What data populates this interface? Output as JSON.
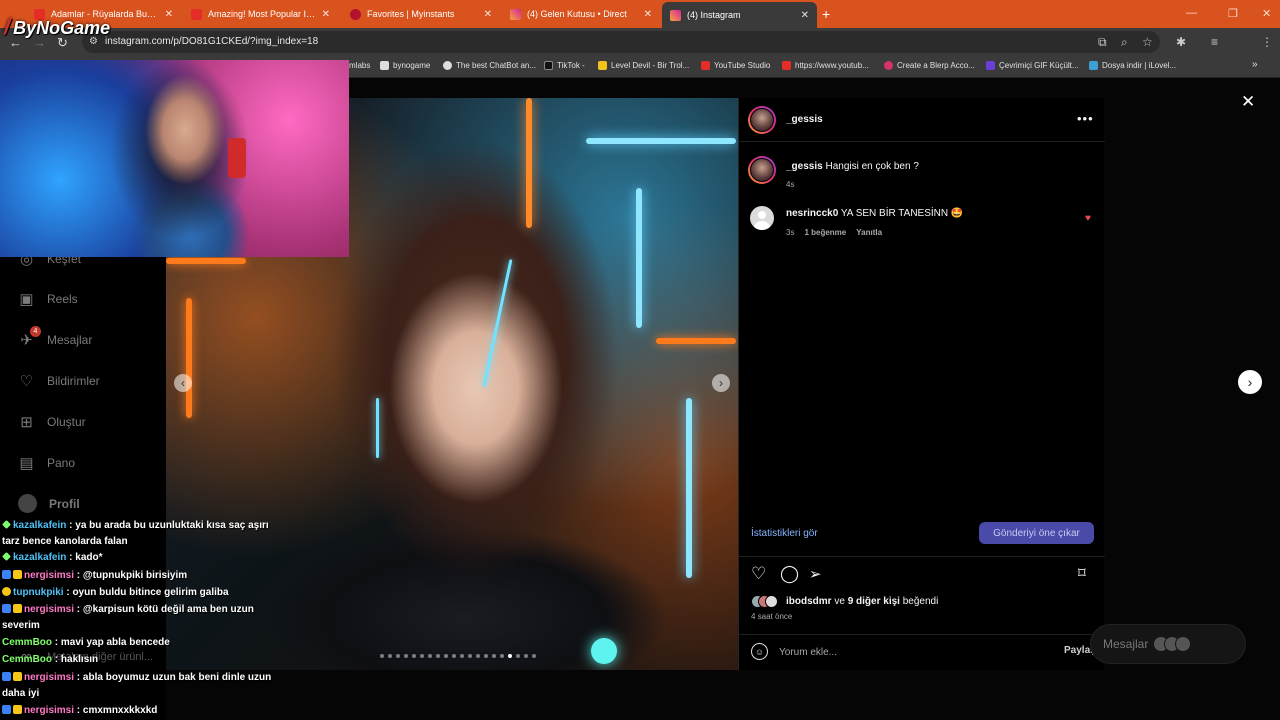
{
  "browser": {
    "tabs": [
      {
        "title": "Adamlar - Rüyalarda Buruşuk...",
        "fav": "#e52d27"
      },
      {
        "title": "Amazing! Most Popular Indian...",
        "fav": "#e52d27"
      },
      {
        "title": "Favorites | Myinstants",
        "fav": "#b3122e"
      },
      {
        "title": "(4) Gelen Kutusu • Direct",
        "fav": "#d6249f"
      },
      {
        "title": "(4) Instagram",
        "fav": "#d6249f"
      }
    ],
    "url": "instagram.com/p/DO81G1CKEd/?img_index=18",
    "bookmarks": [
      {
        "label": "mlabs",
        "color": "#888"
      },
      {
        "label": "bynogame",
        "color": "#ddd"
      },
      {
        "label": "The best ChatBot an...",
        "color": "#ddd"
      },
      {
        "label": "TikTok -",
        "color": "#222"
      },
      {
        "label": "Level Devil - Bir Trol...",
        "color": "#f2c21b"
      },
      {
        "label": "YouTube Studio",
        "color": "#e52d27"
      },
      {
        "label": "https://www.youtub...",
        "color": "#e52d27"
      },
      {
        "label": "Create a Blerp Acco...",
        "color": "#d6336c"
      },
      {
        "label": "Çevrimiçi GIF Küçült...",
        "color": "#6a3fd6"
      },
      {
        "label": "Dosya indir | iLovel...",
        "color": "#3fa0d6"
      }
    ]
  },
  "stream": {
    "logo": "ByNoGame",
    "chat": [
      {
        "badge": "#7fff6a",
        "user": "kazalkafein",
        "ucls": "u-blue",
        "msg": " : ya bu arada bu uzunluktaki kısa saç aşırı tarz bence kanolarda falan"
      },
      {
        "badge": "#7fff6a",
        "user": "kazalkafein",
        "ucls": "u-blue",
        "msg": " : kado*"
      },
      {
        "badge": "#3b82f6",
        "user": "nergisimsi",
        "ucls": "u-pink",
        "msg": " : @tupnukpiki birisiyim"
      },
      {
        "badge": "#f5c518",
        "user": "tupnukpiki",
        "ucls": "u-blue",
        "msg": " : oyun buldu bitince gelirim galiba"
      },
      {
        "badge": "#3b82f6",
        "user": "nergisimsi",
        "ucls": "u-pink",
        "msg": " : @karpisun kötü değil ama ben uzun severim"
      },
      {
        "badge": "",
        "user": "CemmBoo",
        "ucls": "u-green",
        "msg": " : mavi yap abla bencede"
      },
      {
        "badge": "",
        "user": "CemmBoo",
        "ucls": "u-green",
        "msg": " : haklısın"
      },
      {
        "badge": "#3b82f6",
        "user": "nergisimsi",
        "ucls": "u-pink",
        "msg": " : abla boyumuz uzun bak beni dinle uzun daha iyi"
      },
      {
        "badge": "#3b82f6",
        "user": "nergisimsi",
        "ucls": "u-pink",
        "msg": " : cmxmnxxkkxkd"
      }
    ]
  },
  "sidebar": {
    "items": [
      {
        "label": "Keşfet",
        "icon": "compass-icon"
      },
      {
        "label": "Reels",
        "icon": "reels-icon"
      },
      {
        "label": "Mesajlar",
        "icon": "messenger-icon",
        "badge": "4"
      },
      {
        "label": "Bildirimler",
        "icon": "heart-icon"
      },
      {
        "label": "Oluştur",
        "icon": "plus-square-icon"
      },
      {
        "label": "Pano",
        "icon": "dashboard-icon"
      },
      {
        "label": "Profil",
        "icon": "avatar"
      }
    ],
    "hidden_more": "Meta'nın diğer ürünl..."
  },
  "post": {
    "username": "_gessis",
    "caption_user": "_gessis",
    "caption": " Hangisi en çok ben ?",
    "caption_time": "4s",
    "comment_user": "nesrincck0",
    "comment_text": " YA SEN BİR TANESİNN 🤩",
    "comment_time": "3s",
    "comment_likes": "1 beğenme",
    "reply": "Yanıtla",
    "stats_link": "İstatistikleri gör",
    "boost_button": "Gönderiyi öne çıkar",
    "liked_by_user": "ibodsdmr",
    "liked_by_mid": " ve ",
    "liked_by_others": "9 diğer kişi",
    "liked_by_suffix": " beğendi",
    "time_ago": "4 saat önce",
    "comment_placeholder": "Yorum ekle...",
    "post_button": "Paylaş"
  },
  "dm_pill": {
    "label": "Mesajlar"
  },
  "colors": {
    "chrome_tab_strip": "#d9531e",
    "boost": "#4a4aa8",
    "like": "#ed4956"
  }
}
